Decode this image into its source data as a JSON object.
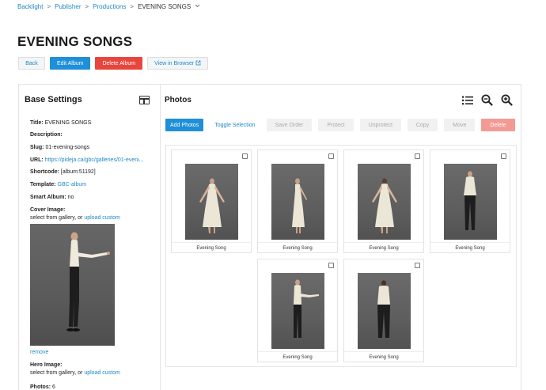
{
  "breadcrumb": {
    "items": [
      "Backlight",
      "Publisher",
      "Productions"
    ],
    "current": "EVENING SONGS",
    "separator": ">"
  },
  "page_title": "EVENING SONGS",
  "actions": {
    "back": "Back",
    "edit": "Edit Album",
    "delete": "Delete Album",
    "view": "View in Browser"
  },
  "base_settings": {
    "heading": "Base Settings",
    "title_label": "Title:",
    "title_value": "EVENING SONGS",
    "description_label": "Description:",
    "slug_label": "Slug:",
    "slug_value": "01-evening-songs",
    "url_label": "URL:",
    "url_value": "https://pideja.ca/gbc/galleries/01-eveni...",
    "shortcode_label": "Shortcode:",
    "shortcode_value": "[album:51192]",
    "template_label": "Template:",
    "template_value": "GBC-album",
    "smart_label": "Smart Album:",
    "smart_value": "no",
    "cover_label": "Cover Image:",
    "cover_hint": "select from gallery, or",
    "cover_upload": "upload custom",
    "remove": "remove",
    "hero_label": "Hero Image:",
    "hero_hint": "select from gallery, or",
    "hero_upload": "upload custom",
    "photos_label": "Photos:",
    "photos_value": "6"
  },
  "photos_panel": {
    "heading": "Photos",
    "toolbar": {
      "add": "Add Photos",
      "toggle": "Toggle Selection",
      "save_order": "Save Order",
      "protect": "Protect",
      "unprotect": "Unprotect",
      "copy": "Copy",
      "move": "Move",
      "delete": "Delete"
    },
    "icons": [
      "list-icon",
      "zoom-out-icon",
      "zoom-in-icon"
    ],
    "photos": [
      {
        "caption": "Evening Song",
        "subject": "woman-front"
      },
      {
        "caption": "Evening Song",
        "subject": "woman-side"
      },
      {
        "caption": "Evening Song",
        "subject": "woman-back"
      },
      {
        "caption": "Evening Song",
        "subject": "man-front"
      },
      {
        "caption": "Evening Song",
        "subject": "man-side"
      },
      {
        "caption": "Evening Song",
        "subject": "man-back"
      }
    ]
  },
  "colors": {
    "link": "#1e88c8",
    "primary": "#1e8fd8",
    "danger": "#e8453c",
    "danger_disabled": "#f39a95"
  }
}
